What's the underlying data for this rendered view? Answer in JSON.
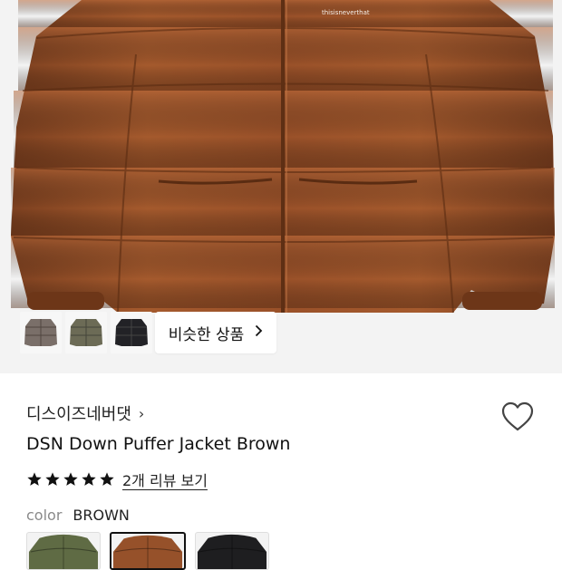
{
  "hero": {
    "thumbnails": [
      {
        "icon": "grey-jacket-thumbnail",
        "color": "#7a6f69"
      },
      {
        "icon": "olive-jacket-thumbnail",
        "color": "#6c6b56"
      },
      {
        "icon": "black-jacket-thumbnail",
        "color": "#222226"
      }
    ],
    "similar_products_label": "비슷한 상품",
    "jacket_color": "#9c5429",
    "chest_logo_text": "thisisneverthat"
  },
  "product": {
    "brand": "디스이즈네버댓",
    "brand_chevron": "›",
    "title": "DSN Down Puffer Jacket Brown",
    "rating_stars": 5,
    "review_link": "2개 리뷰 보기",
    "color_label": "color",
    "color_value": "BROWN",
    "swatches": [
      {
        "name": "green",
        "color": "#5f6b44",
        "selected": false
      },
      {
        "name": "brown",
        "color": "#96512a",
        "selected": true
      },
      {
        "name": "black",
        "color": "#1e1e20",
        "selected": false
      }
    ]
  },
  "icons": {
    "favorite": "heart-icon",
    "star": "star-icon",
    "chevron": "chevron-right-icon"
  }
}
